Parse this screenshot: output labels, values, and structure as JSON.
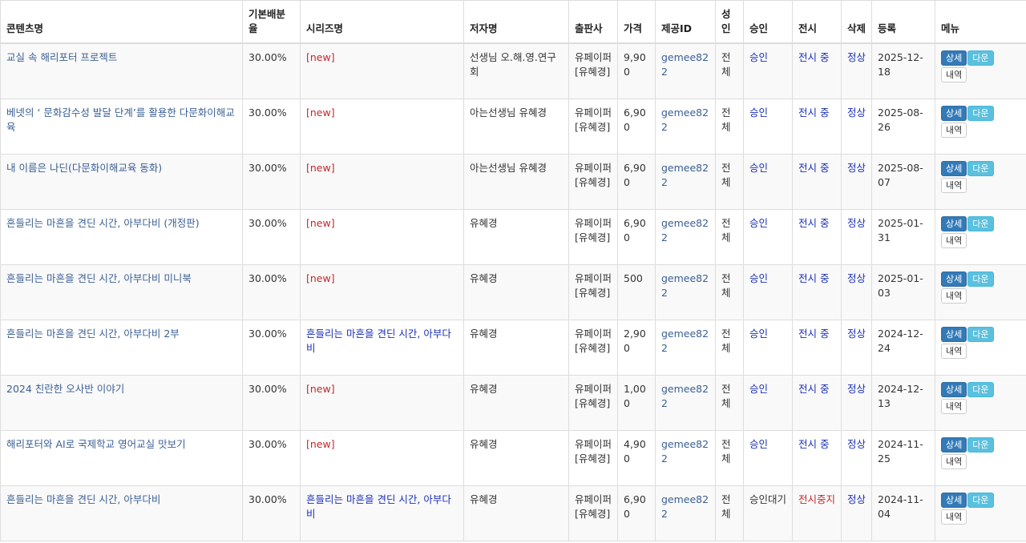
{
  "headers": {
    "title": "콘텐츠명",
    "ratio": "기본배분율",
    "series": "시리즈명",
    "author": "저자명",
    "publisher": "출판사",
    "price": "가격",
    "uid": "제공ID",
    "adult": "성인",
    "approval": "승인",
    "display": "전시",
    "deleted": "삭제",
    "reg": "등록",
    "menu": "메뉴"
  },
  "buttons": {
    "detail": "상세",
    "down": "다운",
    "history": "내역"
  },
  "rows": [
    {
      "title": "교실 속 해리포터 프로젝트",
      "ratio": "30.00%",
      "series": "[new]",
      "series_new": true,
      "author": "선생님 오.해.영.연구회",
      "publisher": "유페이퍼 [유혜경]",
      "price": "9,900",
      "uid": "gemee822",
      "adult": "전체",
      "approval": "승인",
      "display": "전시 중",
      "deleted": "정상",
      "reg": "2025-12-18"
    },
    {
      "title": "베넷의 ‘ 문화감수성 발달 단계’를 활용한 다문화이해교육",
      "ratio": "30.00%",
      "series": "[new]",
      "series_new": true,
      "author": "아는선생님 유혜경",
      "publisher": "유페이퍼 [유혜경]",
      "price": "6,900",
      "uid": "gemee822",
      "adult": "전체",
      "approval": "승인",
      "display": "전시 중",
      "deleted": "정상",
      "reg": "2025-08-26"
    },
    {
      "title": "내 이름은 나딘(다문화이해교육 동화)",
      "ratio": "30.00%",
      "series": "[new]",
      "series_new": true,
      "author": "아는선생님 유혜경",
      "publisher": "유페이퍼 [유혜경]",
      "price": "6,900",
      "uid": "gemee822",
      "adult": "전체",
      "approval": "승인",
      "display": "전시 중",
      "deleted": "정상",
      "reg": "2025-08-07"
    },
    {
      "title": "흔들리는 마흔을 견딘 시간, 아부다비 (개정판)",
      "ratio": "30.00%",
      "series": "[new]",
      "series_new": true,
      "author": "유혜경",
      "publisher": "유페이퍼 [유혜경]",
      "price": "6,900",
      "uid": "gemee822",
      "adult": "전체",
      "approval": "승인",
      "display": "전시 중",
      "deleted": "정상",
      "reg": "2025-01-31"
    },
    {
      "title": "흔들리는 마흔을 견딘 시간, 아부다비 미니북",
      "ratio": "30.00%",
      "series": "[new]",
      "series_new": true,
      "author": "유혜경",
      "publisher": "유페이퍼 [유혜경]",
      "price": "500",
      "uid": "gemee822",
      "adult": "전체",
      "approval": "승인",
      "display": "전시 중",
      "deleted": "정상",
      "reg": "2025-01-03"
    },
    {
      "title": "흔들리는 마흔을 견딘 시간, 아부다비 2부",
      "ratio": "30.00%",
      "series": "흔들리는 마흔을 견딘 시간, 아부다비",
      "series_new": false,
      "author": "유혜경",
      "publisher": "유페이퍼 [유혜경]",
      "price": "2,900",
      "uid": "gemee822",
      "adult": "전체",
      "approval": "승인",
      "display": "전시 중",
      "deleted": "정상",
      "reg": "2024-12-24"
    },
    {
      "title": "2024 친란한 오사반 이야기",
      "ratio": "30.00%",
      "series": "[new]",
      "series_new": true,
      "author": "유혜경",
      "publisher": "유페이퍼 [유혜경]",
      "price": "1,000",
      "uid": "gemee822",
      "adult": "전체",
      "approval": "승인",
      "display": "전시 중",
      "deleted": "정상",
      "reg": "2024-12-13"
    },
    {
      "title": "해리포터와 AI로 국제학교 영어교실 맛보기",
      "ratio": "30.00%",
      "series": "[new]",
      "series_new": true,
      "author": "유혜경",
      "publisher": "유페이퍼 [유혜경]",
      "price": "4,900",
      "uid": "gemee822",
      "adult": "전체",
      "approval": "승인",
      "display": "전시 중",
      "deleted": "정상",
      "reg": "2024-11-25"
    },
    {
      "title": "흔들리는 마흔을 견딘 시간, 아부다비",
      "ratio": "30.00%",
      "series": "흔들리는 마흔을 견딘 시간, 아부다비",
      "series_new": false,
      "author": "유혜경",
      "publisher": "유페이퍼 [유혜경]",
      "price": "6,900",
      "uid": "gemee822",
      "adult": "전체",
      "approval": "승인대기",
      "approval_wait": true,
      "display": "전시중지",
      "display_stop": true,
      "deleted": "정상",
      "reg": "2024-11-04"
    }
  ]
}
